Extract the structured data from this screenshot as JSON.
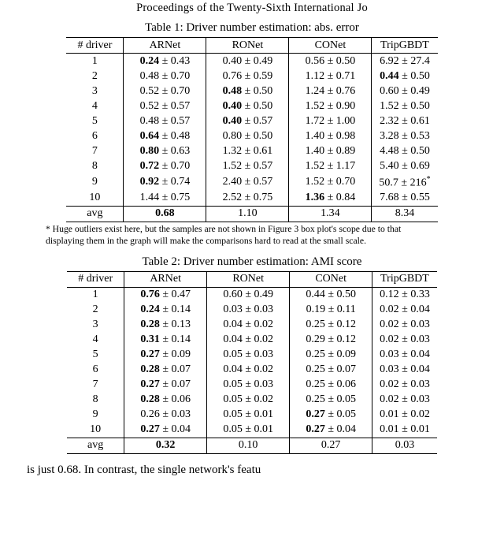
{
  "header_cut": "Proceedings of the Twenty-Sixth International Jo",
  "table1": {
    "caption": "Table 1: Driver number estimation: abs. error",
    "cols": [
      "# driver",
      "ARNet",
      "RONet",
      "CONet",
      "TripGBDT"
    ],
    "rows": [
      {
        "n": "1",
        "ARNet": {
          "m": "0.24",
          "s": "0.43",
          "b": true
        },
        "RONet": {
          "m": "0.40",
          "s": "0.49"
        },
        "CONet": {
          "m": "0.56",
          "s": "0.50"
        },
        "TripGBDT": {
          "m": "6.92",
          "s": "27.4"
        }
      },
      {
        "n": "2",
        "ARNet": {
          "m": "0.48",
          "s": "0.70"
        },
        "RONet": {
          "m": "0.76",
          "s": "0.59"
        },
        "CONet": {
          "m": "1.12",
          "s": "0.71"
        },
        "TripGBDT": {
          "m": "0.44",
          "s": "0.50",
          "b": true
        }
      },
      {
        "n": "3",
        "ARNet": {
          "m": "0.52",
          "s": "0.70"
        },
        "RONet": {
          "m": "0.48",
          "s": "0.50",
          "b": true
        },
        "CONet": {
          "m": "1.24",
          "s": "0.76"
        },
        "TripGBDT": {
          "m": "0.60",
          "s": "0.49"
        }
      },
      {
        "n": "4",
        "ARNet": {
          "m": "0.52",
          "s": "0.57"
        },
        "RONet": {
          "m": "0.40",
          "s": "0.50",
          "b": true
        },
        "CONet": {
          "m": "1.52",
          "s": "0.90"
        },
        "TripGBDT": {
          "m": "1.52",
          "s": "0.50"
        }
      },
      {
        "n": "5",
        "ARNet": {
          "m": "0.48",
          "s": "0.57"
        },
        "RONet": {
          "m": "0.40",
          "s": "0.57",
          "b": true
        },
        "CONet": {
          "m": "1.72",
          "s": "1.00"
        },
        "TripGBDT": {
          "m": "2.32",
          "s": "0.61"
        }
      },
      {
        "n": "6",
        "ARNet": {
          "m": "0.64",
          "s": "0.48",
          "b": true
        },
        "RONet": {
          "m": "0.80",
          "s": "0.50"
        },
        "CONet": {
          "m": "1.40",
          "s": "0.98"
        },
        "TripGBDT": {
          "m": "3.28",
          "s": "0.53"
        }
      },
      {
        "n": "7",
        "ARNet": {
          "m": "0.80",
          "s": "0.63",
          "b": true
        },
        "RONet": {
          "m": "1.32",
          "s": "0.61"
        },
        "CONet": {
          "m": "1.40",
          "s": "0.89"
        },
        "TripGBDT": {
          "m": "4.48",
          "s": "0.50"
        }
      },
      {
        "n": "8",
        "ARNet": {
          "m": "0.72",
          "s": "0.70",
          "b": true
        },
        "RONet": {
          "m": "1.52",
          "s": "0.57"
        },
        "CONet": {
          "m": "1.52",
          "s": "1.17"
        },
        "TripGBDT": {
          "m": "5.40",
          "s": "0.69"
        }
      },
      {
        "n": "9",
        "ARNet": {
          "m": "0.92",
          "s": "0.74",
          "b": true
        },
        "RONet": {
          "m": "2.40",
          "s": "0.57"
        },
        "CONet": {
          "m": "1.52",
          "s": "0.70"
        },
        "TripGBDT": {
          "m": "50.7",
          "s": "216",
          "star": true
        }
      },
      {
        "n": "10",
        "ARNet": {
          "m": "1.44",
          "s": "0.75"
        },
        "RONet": {
          "m": "2.52",
          "s": "0.75"
        },
        "CONet": {
          "m": "1.36",
          "s": "0.84",
          "b": true
        },
        "TripGBDT": {
          "m": "7.68",
          "s": "0.55"
        }
      }
    ],
    "avg": {
      "label": "avg",
      "ARNet": {
        "v": "0.68",
        "b": true
      },
      "RONet": {
        "v": "1.10"
      },
      "CONet": {
        "v": "1.34"
      },
      "TripGBDT": {
        "v": "8.34"
      }
    }
  },
  "footnote": {
    "star": "*",
    "text1": " Huge outliers exist here, but the samples are not shown in Figure 3 box plot's scope due to that",
    "text2": "displaying them in the graph will make the comparisons hard to read at the small scale."
  },
  "table2": {
    "caption": "Table 2: Driver number estimation: AMI score",
    "cols": [
      "# driver",
      "ARNet",
      "RONet",
      "CONet",
      "TripGBDT"
    ],
    "rows": [
      {
        "n": "1",
        "ARNet": {
          "m": "0.76",
          "s": "0.47",
          "b": true
        },
        "RONet": {
          "m": "0.60",
          "s": "0.49"
        },
        "CONet": {
          "m": "0.44",
          "s": "0.50"
        },
        "TripGBDT": {
          "m": "0.12",
          "s": "0.33"
        }
      },
      {
        "n": "2",
        "ARNet": {
          "m": "0.24",
          "s": "0.14",
          "b": true
        },
        "RONet": {
          "m": "0.03",
          "s": "0.03"
        },
        "CONet": {
          "m": "0.19",
          "s": "0.11"
        },
        "TripGBDT": {
          "m": "0.02",
          "s": "0.04"
        }
      },
      {
        "n": "3",
        "ARNet": {
          "m": "0.28",
          "s": "0.13",
          "b": true
        },
        "RONet": {
          "m": "0.04",
          "s": "0.02"
        },
        "CONet": {
          "m": "0.25",
          "s": "0.12"
        },
        "TripGBDT": {
          "m": "0.02",
          "s": "0.03"
        }
      },
      {
        "n": "4",
        "ARNet": {
          "m": "0.31",
          "s": "0.14",
          "b": true
        },
        "RONet": {
          "m": "0.04",
          "s": "0.02"
        },
        "CONet": {
          "m": "0.29",
          "s": "0.12"
        },
        "TripGBDT": {
          "m": "0.02",
          "s": "0.03"
        }
      },
      {
        "n": "5",
        "ARNet": {
          "m": "0.27",
          "s": "0.09",
          "b": true
        },
        "RONet": {
          "m": "0.05",
          "s": "0.03"
        },
        "CONet": {
          "m": "0.25",
          "s": "0.09"
        },
        "TripGBDT": {
          "m": "0.03",
          "s": "0.04"
        }
      },
      {
        "n": "6",
        "ARNet": {
          "m": "0.28",
          "s": "0.07",
          "b": true
        },
        "RONet": {
          "m": "0.04",
          "s": "0.02"
        },
        "CONet": {
          "m": "0.25",
          "s": "0.07"
        },
        "TripGBDT": {
          "m": "0.03",
          "s": "0.04"
        }
      },
      {
        "n": "7",
        "ARNet": {
          "m": "0.27",
          "s": "0.07",
          "b": true
        },
        "RONet": {
          "m": "0.05",
          "s": "0.03"
        },
        "CONet": {
          "m": "0.25",
          "s": "0.06"
        },
        "TripGBDT": {
          "m": "0.02",
          "s": "0.03"
        }
      },
      {
        "n": "8",
        "ARNet": {
          "m": "0.28",
          "s": "0.06",
          "b": true
        },
        "RONet": {
          "m": "0.05",
          "s": "0.02"
        },
        "CONet": {
          "m": "0.25",
          "s": "0.05"
        },
        "TripGBDT": {
          "m": "0.02",
          "s": "0.03"
        }
      },
      {
        "n": "9",
        "ARNet": {
          "m": "0.26",
          "s": "0.03"
        },
        "RONet": {
          "m": "0.05",
          "s": "0.01"
        },
        "CONet": {
          "m": "0.27",
          "s": "0.05",
          "b": true
        },
        "TripGBDT": {
          "m": "0.01",
          "s": "0.02"
        }
      },
      {
        "n": "10",
        "ARNet": {
          "m": "0.27",
          "s": "0.04",
          "b": true
        },
        "RONet": {
          "m": "0.05",
          "s": "0.01"
        },
        "CONet": {
          "m": "0.27",
          "s": "0.04",
          "b": true
        },
        "TripGBDT": {
          "m": "0.01",
          "s": "0.01"
        }
      }
    ],
    "avg": {
      "label": "avg",
      "ARNet": {
        "v": "0.32",
        "b": true
      },
      "RONet": {
        "v": "0.10"
      },
      "CONet": {
        "v": "0.27"
      },
      "TripGBDT": {
        "v": "0.03"
      }
    }
  },
  "bottom_cut": {
    "left": "is just 0.68.   In contrast, the single  network's featu",
    "right": ""
  },
  "chart_data": [
    {
      "type": "table",
      "title": "Driver number estimation: abs. error",
      "columns": [
        "# driver",
        "ARNet",
        "RONet",
        "CONet",
        "TripGBDT"
      ],
      "data": [
        [
          1,
          0.24,
          0.4,
          0.56,
          6.92
        ],
        [
          2,
          0.48,
          0.76,
          1.12,
          0.44
        ],
        [
          3,
          0.52,
          0.48,
          1.24,
          0.6
        ],
        [
          4,
          0.52,
          0.4,
          1.52,
          1.52
        ],
        [
          5,
          0.48,
          0.4,
          1.72,
          2.32
        ],
        [
          6,
          0.64,
          0.8,
          1.4,
          3.28
        ],
        [
          7,
          0.8,
          1.32,
          1.4,
          4.48
        ],
        [
          8,
          0.72,
          1.52,
          1.52,
          5.4
        ],
        [
          9,
          0.92,
          2.4,
          1.52,
          50.7
        ],
        [
          10,
          1.44,
          2.52,
          1.36,
          7.68
        ]
      ],
      "stdev": [
        [
          0.43,
          0.49,
          0.5,
          27.4
        ],
        [
          0.7,
          0.59,
          0.71,
          0.5
        ],
        [
          0.7,
          0.5,
          0.76,
          0.49
        ],
        [
          0.57,
          0.5,
          0.9,
          0.5
        ],
        [
          0.57,
          0.57,
          1.0,
          0.61
        ],
        [
          0.48,
          0.5,
          0.98,
          0.53
        ],
        [
          0.63,
          0.61,
          0.89,
          0.5
        ],
        [
          0.7,
          0.57,
          1.17,
          0.69
        ],
        [
          0.74,
          0.57,
          0.7,
          216
        ],
        [
          0.75,
          0.75,
          0.84,
          0.55
        ]
      ],
      "avg": [
        0.68,
        1.1,
        1.34,
        8.34
      ]
    },
    {
      "type": "table",
      "title": "Driver number estimation: AMI score",
      "columns": [
        "# driver",
        "ARNet",
        "RONet",
        "CONet",
        "TripGBDT"
      ],
      "data": [
        [
          1,
          0.76,
          0.6,
          0.44,
          0.12
        ],
        [
          2,
          0.24,
          0.03,
          0.19,
          0.02
        ],
        [
          3,
          0.28,
          0.04,
          0.25,
          0.02
        ],
        [
          4,
          0.31,
          0.04,
          0.29,
          0.02
        ],
        [
          5,
          0.27,
          0.05,
          0.25,
          0.03
        ],
        [
          6,
          0.28,
          0.04,
          0.25,
          0.03
        ],
        [
          7,
          0.27,
          0.05,
          0.25,
          0.02
        ],
        [
          8,
          0.28,
          0.05,
          0.25,
          0.02
        ],
        [
          9,
          0.26,
          0.05,
          0.27,
          0.01
        ],
        [
          10,
          0.27,
          0.05,
          0.27,
          0.01
        ]
      ],
      "stdev": [
        [
          0.47,
          0.49,
          0.5,
          0.33
        ],
        [
          0.14,
          0.03,
          0.11,
          0.04
        ],
        [
          0.13,
          0.02,
          0.12,
          0.03
        ],
        [
          0.14,
          0.02,
          0.12,
          0.03
        ],
        [
          0.09,
          0.03,
          0.09,
          0.04
        ],
        [
          0.07,
          0.02,
          0.07,
          0.04
        ],
        [
          0.07,
          0.03,
          0.06,
          0.03
        ],
        [
          0.06,
          0.02,
          0.05,
          0.03
        ],
        [
          0.03,
          0.01,
          0.05,
          0.02
        ],
        [
          0.04,
          0.01,
          0.04,
          0.01
        ]
      ],
      "avg": [
        0.32,
        0.1,
        0.27,
        0.03
      ]
    }
  ]
}
